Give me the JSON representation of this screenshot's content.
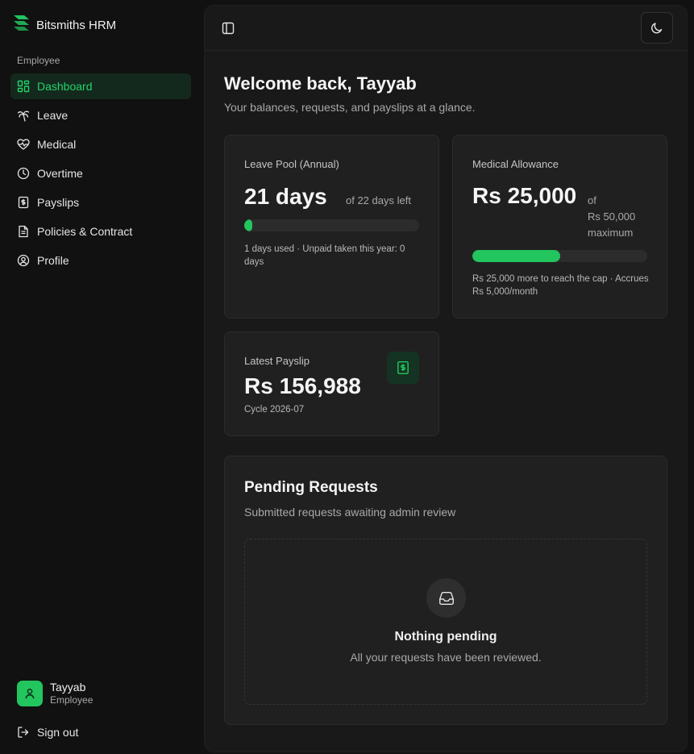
{
  "brand": {
    "name": "Bitsmiths HRM"
  },
  "sidebar": {
    "section_label": "Employee",
    "items": [
      {
        "label": "Dashboard",
        "icon": "dashboard-icon",
        "active": true
      },
      {
        "label": "Leave",
        "icon": "palm-tree-icon"
      },
      {
        "label": "Medical",
        "icon": "heart-pulse-icon"
      },
      {
        "label": "Overtime",
        "icon": "clock-icon"
      },
      {
        "label": "Payslips",
        "icon": "receipt-icon"
      },
      {
        "label": "Policies & Contract",
        "icon": "file-text-icon"
      },
      {
        "label": "Profile",
        "icon": "user-circle-icon"
      }
    ],
    "user": {
      "name": "Tayyab",
      "role": "Employee"
    },
    "signout_label": "Sign out"
  },
  "header": {
    "title": "Welcome back, Tayyab",
    "subtitle": "Your balances, requests, and payslips at a glance."
  },
  "leave_card": {
    "label": "Leave Pool (Annual)",
    "value": "21 days",
    "side": "of 22 days left",
    "progress": 0.045,
    "note": "1 days used · Unpaid taken this year: 0 days"
  },
  "medical_card": {
    "label": "Medical Allowance",
    "value": "Rs 25,000",
    "side_of": "of",
    "side_max": "Rs 50,000 maximum",
    "progress": 0.5,
    "note": "Rs 25,000 more to reach the cap · Accrues Rs 5,000/month"
  },
  "payslip_card": {
    "label": "Latest Payslip",
    "value": "Rs 156,988",
    "cycle": "Cycle 2026-07"
  },
  "pending": {
    "title": "Pending Requests",
    "subtitle": "Submitted requests awaiting admin review",
    "empty_title": "Nothing pending",
    "empty_sub": "All your requests have been reviewed."
  },
  "colors": {
    "accent": "#22c55e",
    "active_bg": "#14291d",
    "background": "#111111",
    "card": "#202020"
  }
}
